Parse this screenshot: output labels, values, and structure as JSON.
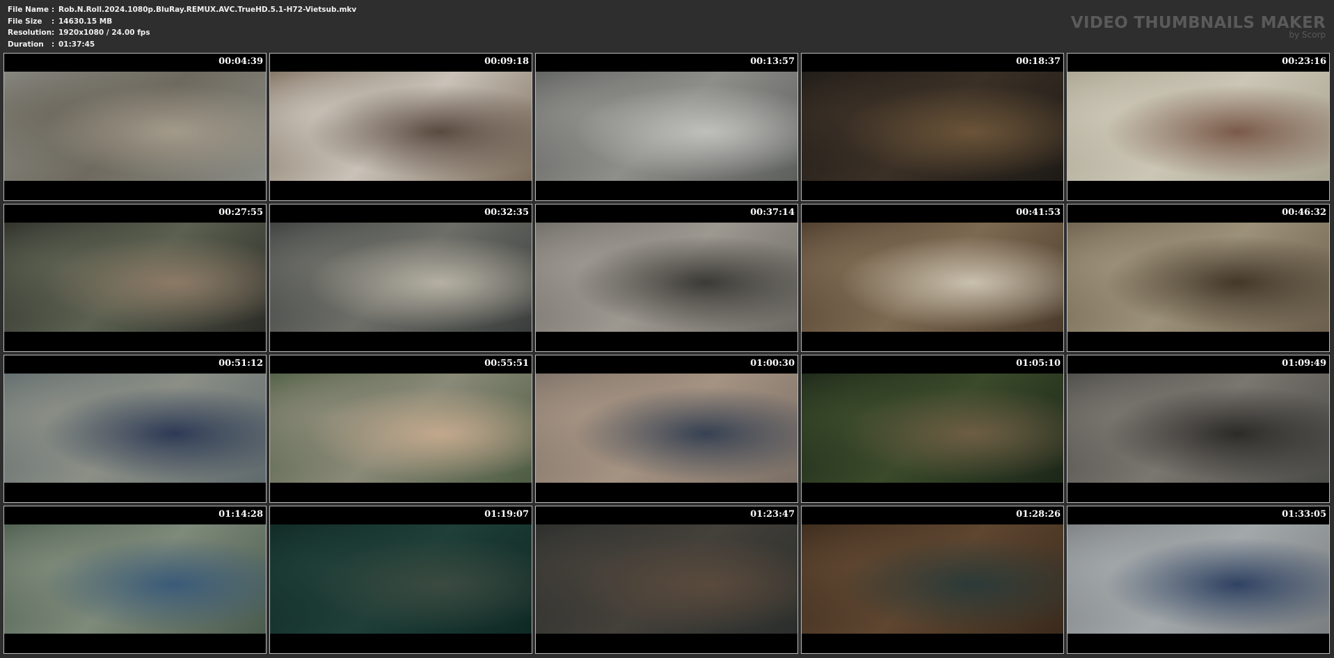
{
  "info": {
    "file_name_label": "File Name",
    "file_name": "Rob.N.Roll.2024.1080p.BluRay.REMUX.AVC.TrueHD.5.1-H72-Vietsub.mkv",
    "file_size_label": "File Size",
    "file_size": "14630.15 MB",
    "resolution_label": "Resolution",
    "resolution": "1920x1080 / 24.00 fps",
    "duration_label": "Duration",
    "duration": "01:37:45",
    "separator": ":"
  },
  "brand": {
    "title": "VIDEO THUMBNAILS MAKER",
    "subtitle": "by Scorp"
  },
  "thumbnails": [
    {
      "time": "00:04:39",
      "colors": [
        "#8a8c85",
        "#6f6a5f",
        "#a39a8a"
      ]
    },
    {
      "time": "00:09:18",
      "colors": [
        "#7a6b5a",
        "#c9c2b8",
        "#5a4a40"
      ]
    },
    {
      "time": "00:13:57",
      "colors": [
        "#5d5f5c",
        "#8e8e8a",
        "#bfc0bc"
      ]
    },
    {
      "time": "00:18:37",
      "colors": [
        "#1d1a16",
        "#3b3026",
        "#6b5438"
      ]
    },
    {
      "time": "00:23:16",
      "colors": [
        "#a8a291",
        "#cbc6b5",
        "#7a5a4a"
      ]
    },
    {
      "time": "00:27:55",
      "colors": [
        "#2b2c27",
        "#5b6050",
        "#8c7a66"
      ]
    },
    {
      "time": "00:32:35",
      "colors": [
        "#3a3d3c",
        "#6d6e68",
        "#b5b0a2"
      ]
    },
    {
      "time": "00:37:14",
      "colors": [
        "#6c6a64",
        "#9d9890",
        "#3b3a36"
      ]
    },
    {
      "time": "00:41:53",
      "colors": [
        "#4a3a2a",
        "#7d6a52",
        "#c9c0ae"
      ]
    },
    {
      "time": "00:46:32",
      "colors": [
        "#6a5e4c",
        "#9c9179",
        "#433829"
      ]
    },
    {
      "time": "00:51:12",
      "colors": [
        "#5f6a6d",
        "#8b8f86",
        "#2d3a55"
      ]
    },
    {
      "time": "00:55:51",
      "colors": [
        "#4d5c43",
        "#8a8a78",
        "#c2a88c"
      ]
    },
    {
      "time": "01:00:30",
      "colors": [
        "#7a6f66",
        "#a59382",
        "#364152"
      ]
    },
    {
      "time": "01:05:10",
      "colors": [
        "#1c2619",
        "#3a4a2a",
        "#6d5d44"
      ]
    },
    {
      "time": "01:09:49",
      "colors": [
        "#4a4a46",
        "#7a7670",
        "#2c2b28"
      ]
    },
    {
      "time": "01:14:28",
      "colors": [
        "#4a5b4d",
        "#7e8a7a",
        "#3a5a78"
      ]
    },
    {
      "time": "01:19:07",
      "colors": [
        "#0f2824",
        "#1f3f38",
        "#3b4a40"
      ]
    },
    {
      "time": "01:23:47",
      "colors": [
        "#2a2e2c",
        "#44403a",
        "#5a4a3c"
      ]
    },
    {
      "time": "01:28:26",
      "colors": [
        "#3a2a1c",
        "#5e4630",
        "#2b3a38"
      ]
    },
    {
      "time": "01:33:05",
      "colors": [
        "#7a7e80",
        "#a3a8aa",
        "#2f4262"
      ]
    }
  ]
}
